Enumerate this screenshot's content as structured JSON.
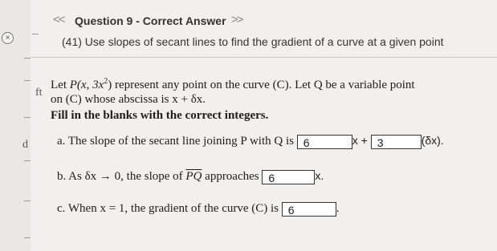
{
  "header": {
    "title": "Question 9 - Correct Answer",
    "prev_glyph": "<<",
    "next_glyph": ">>"
  },
  "close_glyph": "×",
  "subtitle": "(41) Use slopes of secant lines to find the gradient of a curve at a given point",
  "side": {
    "a": "ft",
    "b": "d"
  },
  "intro": {
    "line1_a": "Let ",
    "line1_p": "P(x, 3x",
    "line1_exp": "2",
    "line1_b": ")",
    "line1_c": " represent any point on the curve (C). Let Q be a variable point",
    "line2": "on (C) whose abscissa is x + δx.",
    "line3": "Fill in the blanks with the correct integers."
  },
  "parts": {
    "a": {
      "prefix": "a. The slope of the secant line joining P with Q is ",
      "mid": "x + ",
      "suffix": "(δx).",
      "answer1": "6",
      "answer2": "3"
    },
    "b": {
      "prefix": "b. As δx → 0, the slope of ",
      "pq": "PQ",
      "middle": " approaches ",
      "suffix": "x.",
      "answer": "6"
    },
    "c": {
      "prefix": "c. When x = 1, the gradient of the curve (C) is ",
      "suffix": ".",
      "answer": "6"
    }
  }
}
